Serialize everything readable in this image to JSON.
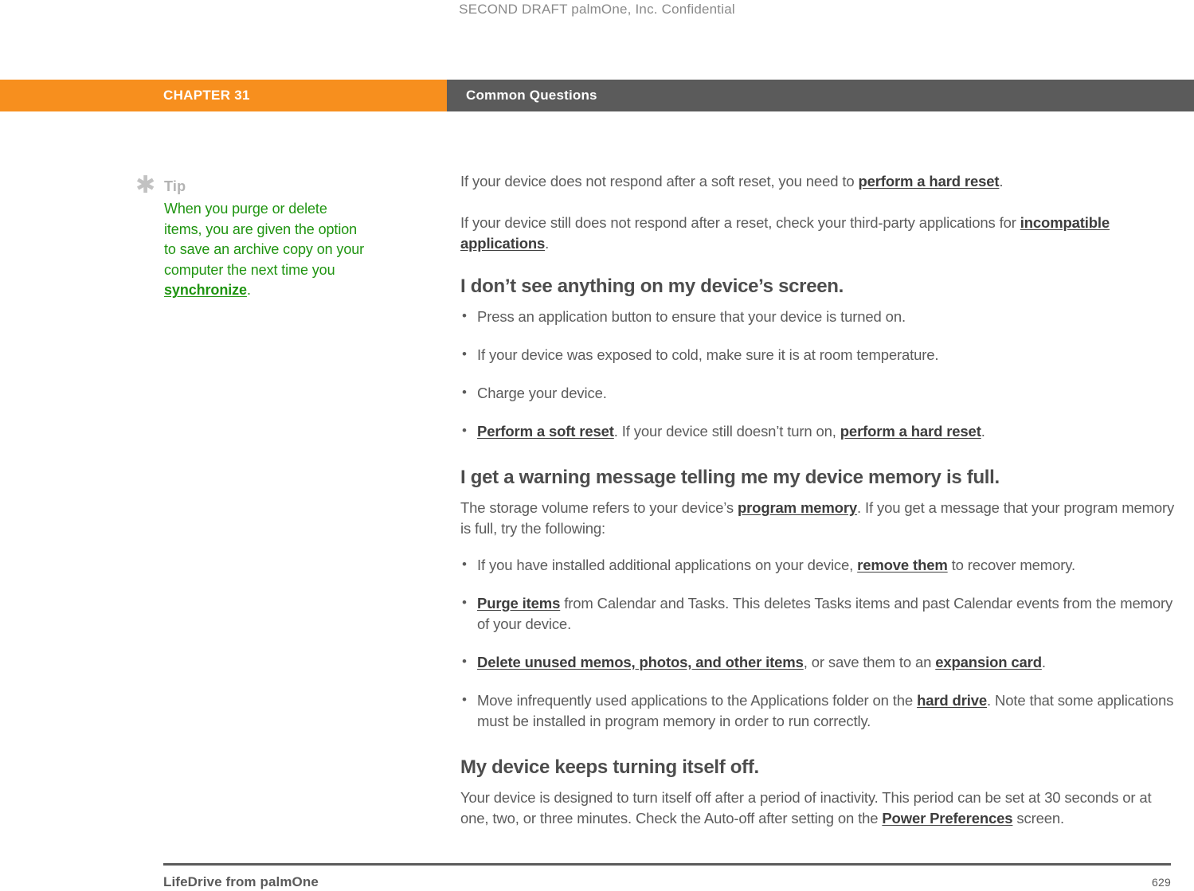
{
  "header": {
    "draft_notice": "SECOND DRAFT palmOne, Inc.  Confidential"
  },
  "chapter_bar": {
    "chapter_label": "CHAPTER 31",
    "chapter_title": "Common Questions",
    "orange_hex": "#f78f1e",
    "gray_hex": "#5b5b5b"
  },
  "tip": {
    "icon": "asterisk-icon",
    "glyph": "✱",
    "label": "Tip",
    "text_before_link": "When you purge or delete items, you are given the option to save an archive copy on your computer the next time you ",
    "link": "synchronize",
    "text_after_link": ".",
    "color_hex": "#1f9410"
  },
  "main": {
    "intro_paragraphs": [
      {
        "before": "If your device does not respond after a soft reset, you need to ",
        "link": "perform a hard reset",
        "after": "."
      },
      {
        "before": "If your device still does not respond after a reset, check your third-party applications for ",
        "link": "incompatible applications",
        "after": "."
      }
    ],
    "sections": [
      {
        "heading": "I don’t see anything on my device’s screen.",
        "bullets": [
          {
            "before": "Press an application button to ensure that your device is turned on.",
            "link": "",
            "after": ""
          },
          {
            "before": "If your device was exposed to cold, make sure it is at room temperature.",
            "link": "",
            "after": ""
          },
          {
            "before": "Charge your device.",
            "link": "",
            "after": ""
          },
          {
            "before": "",
            "link": "Perform a soft reset",
            "mid": ". If your device still doesn’t turn on, ",
            "link2": "perform a hard reset",
            "after": "."
          }
        ]
      },
      {
        "heading": "I get a warning message telling me my device memory is full.",
        "lead": {
          "before": "The storage volume refers to your device’s ",
          "link": "program memory",
          "after": ". If you get a message that your program memory is full, try the following:"
        },
        "bullets": [
          {
            "before": "If you have installed additional applications on your device, ",
            "link": "remove them",
            "after": " to recover memory."
          },
          {
            "before": "",
            "link": "Purge items",
            "after": " from Calendar and Tasks. This deletes Tasks items and past Calendar events from the memory of your device."
          },
          {
            "before": "",
            "link": "Delete unused memos, photos, and other items",
            "mid": ", or save them to an ",
            "link2": "expansion card",
            "after": "."
          },
          {
            "before": "Move infrequently used applications to the Applications folder on the ",
            "link": "hard drive",
            "after": ". Note that some applications must be installed in program memory in order to run correctly."
          }
        ]
      },
      {
        "heading": "My device keeps turning itself off.",
        "lead": {
          "before": "Your device is designed to turn itself off after a period of inactivity. This period can be set at 30 seconds or at one, two, or three minutes. Check the Auto-off after setting on the ",
          "link": "Power Preferences",
          "after": " screen."
        }
      }
    ]
  },
  "footer": {
    "product": "LifeDrive from palmOne",
    "page_number": "629"
  }
}
